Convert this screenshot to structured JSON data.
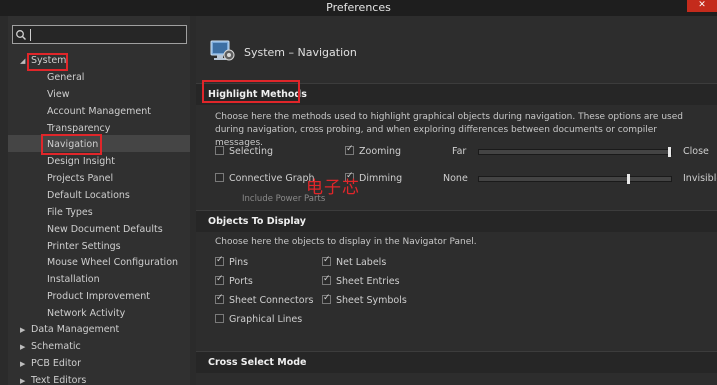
{
  "window": {
    "title": "Preferences",
    "close_label": "✕"
  },
  "tree": {
    "items": [
      {
        "label": "System",
        "expanded": true
      },
      {
        "label": "General"
      },
      {
        "label": "View"
      },
      {
        "label": "Account Management"
      },
      {
        "label": "Transparency"
      },
      {
        "label": "Navigation",
        "selected": true
      },
      {
        "label": "Design Insight"
      },
      {
        "label": "Projects Panel"
      },
      {
        "label": "Default Locations"
      },
      {
        "label": "File Types"
      },
      {
        "label": "New Document Defaults"
      },
      {
        "label": "Printer Settings"
      },
      {
        "label": "Mouse Wheel Configuration"
      },
      {
        "label": "Installation"
      },
      {
        "label": "Product Improvement"
      },
      {
        "label": "Network Activity"
      },
      {
        "label": "Data Management"
      },
      {
        "label": "Schematic"
      },
      {
        "label": "PCB Editor"
      },
      {
        "label": "Text Editors"
      }
    ]
  },
  "page": {
    "title": "System – Navigation"
  },
  "highlight": {
    "heading": "Highlight Methods",
    "description": "Choose here the methods used to highlight graphical objects during navigation. These options are used during navigation, cross probing, and when exploring differences between documents or compiler messages.",
    "selecting": {
      "label": "Selecting",
      "checked": false
    },
    "zooming": {
      "label": "Zooming",
      "checked": true
    },
    "connective": {
      "label": "Connective Graph",
      "checked": false
    },
    "include_power": "Include Power Parts",
    "dimming": {
      "label": "Dimming",
      "checked": true
    },
    "zoom_min": "Far",
    "zoom_max": "Close",
    "zoom_level": 0.98,
    "dim_min": "None",
    "dim_max": "Invisible",
    "dim_level": 0.78
  },
  "objects": {
    "heading": "Objects To Display",
    "description": "Choose here the objects to display in the Navigator Panel.",
    "pins": {
      "label": "Pins",
      "checked": true
    },
    "net_labels": {
      "label": "Net Labels",
      "checked": true
    },
    "ports": {
      "label": "Ports",
      "checked": true
    },
    "sheet_entries": {
      "label": "Sheet Entries",
      "checked": true
    },
    "sheet_connectors": {
      "label": "Sheet Connectors",
      "checked": true
    },
    "sheet_symbols": {
      "label": "Sheet Symbols",
      "checked": true
    },
    "graphical_lines": {
      "label": "Graphical Lines",
      "checked": false
    }
  },
  "cross": {
    "heading": "Cross Select Mode"
  },
  "watermark": "电子芯"
}
